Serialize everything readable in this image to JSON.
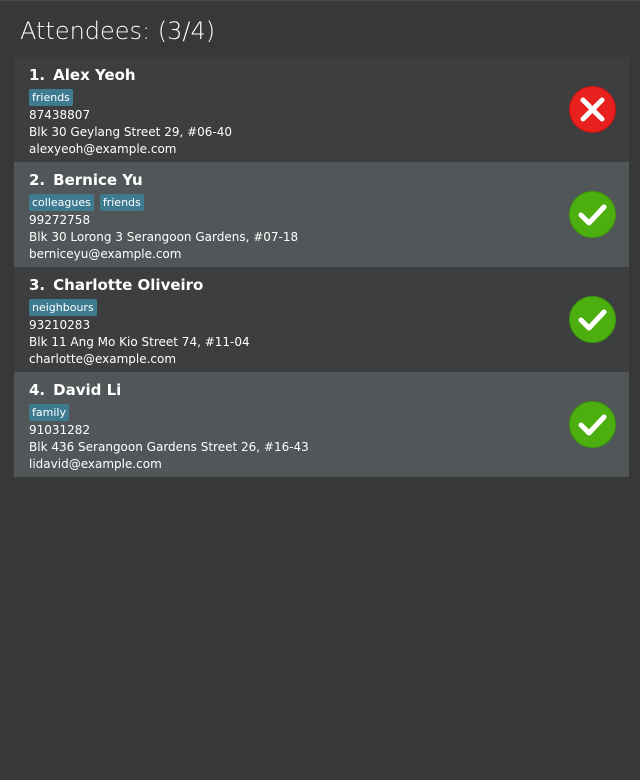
{
  "header": {
    "title": "Attendees: (3/4)"
  },
  "colors": {
    "present": "#4caf0f",
    "absent": "#e8201e",
    "tag": "#3e7b91"
  },
  "attendees": [
    {
      "index": "1.",
      "name": "Alex Yeoh",
      "tags": [
        "friends"
      ],
      "phone": "87438807",
      "address": "Blk 30 Geylang Street 29, #06-40",
      "email": "alexyeoh@example.com",
      "status_icon": "cross-icon",
      "present": false
    },
    {
      "index": "2.",
      "name": "Bernice Yu",
      "tags": [
        "colleagues",
        "friends"
      ],
      "phone": "99272758",
      "address": "Blk 30 Lorong 3 Serangoon Gardens, #07-18",
      "email": "berniceyu@example.com",
      "status_icon": "check-icon",
      "present": true
    },
    {
      "index": "3.",
      "name": "Charlotte Oliveiro",
      "tags": [
        "neighbours"
      ],
      "phone": "93210283",
      "address": "Blk 11 Ang Mo Kio Street 74, #11-04",
      "email": "charlotte@example.com",
      "status_icon": "check-icon",
      "present": true
    },
    {
      "index": "4.",
      "name": "David Li",
      "tags": [
        "family"
      ],
      "phone": "91031282",
      "address": "Blk 436 Serangoon Gardens Street 26, #16-43",
      "email": "lidavid@example.com",
      "status_icon": "check-icon",
      "present": true
    }
  ]
}
